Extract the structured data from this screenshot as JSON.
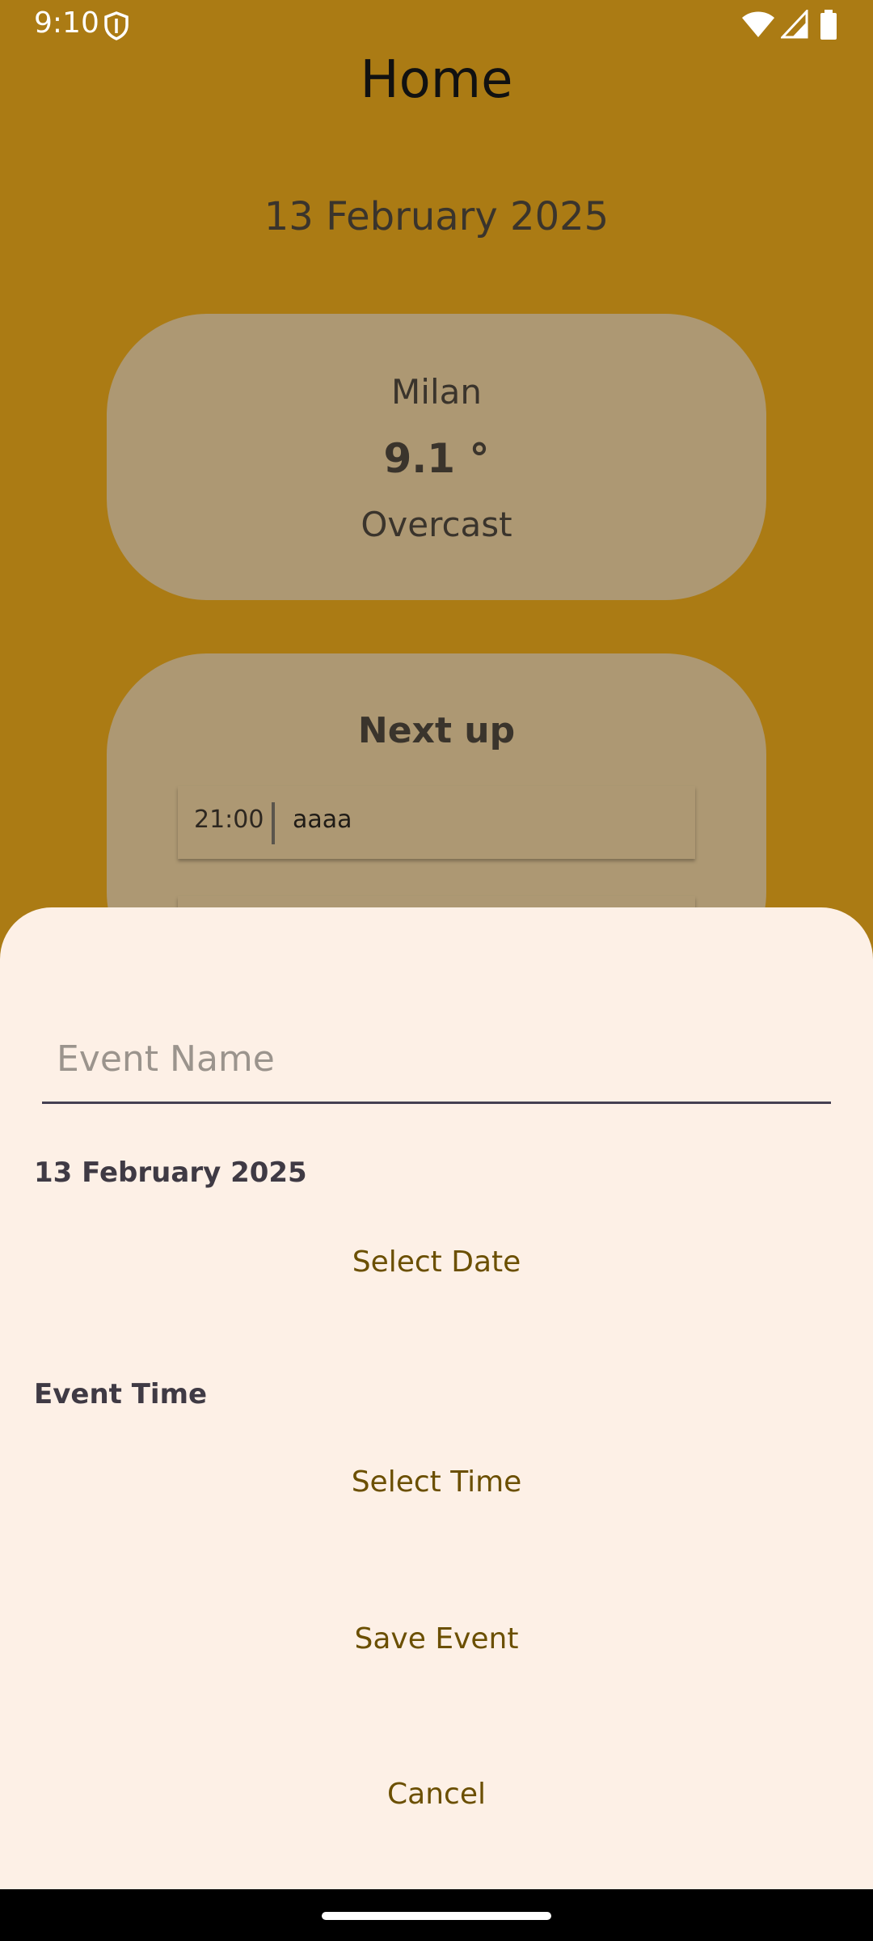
{
  "status_bar": {
    "time": "9:10",
    "icons": [
      "shield-icon",
      "wifi-icon",
      "signal-icon",
      "battery-icon"
    ]
  },
  "home": {
    "title": "Home",
    "date": "13 February 2025"
  },
  "weather": {
    "city": "Milan",
    "temperature": "9.1 °",
    "condition": "Overcast"
  },
  "next_up": {
    "title": "Next up",
    "events": [
      {
        "time": "21:00",
        "name": "aaaa"
      }
    ]
  },
  "sheet": {
    "event_name_placeholder": "Event Name",
    "event_name_value": "",
    "date_label": "13 February 2025",
    "select_date_label": "Select Date",
    "time_label": "Event Time",
    "select_time_label": "Select Time",
    "save_label": "Save Event",
    "cancel_label": "Cancel"
  },
  "colors": {
    "background": "#ab7b14",
    "card": "#ad9873",
    "sheet": "#fdf0e6",
    "button_text": "#6b4f00"
  }
}
